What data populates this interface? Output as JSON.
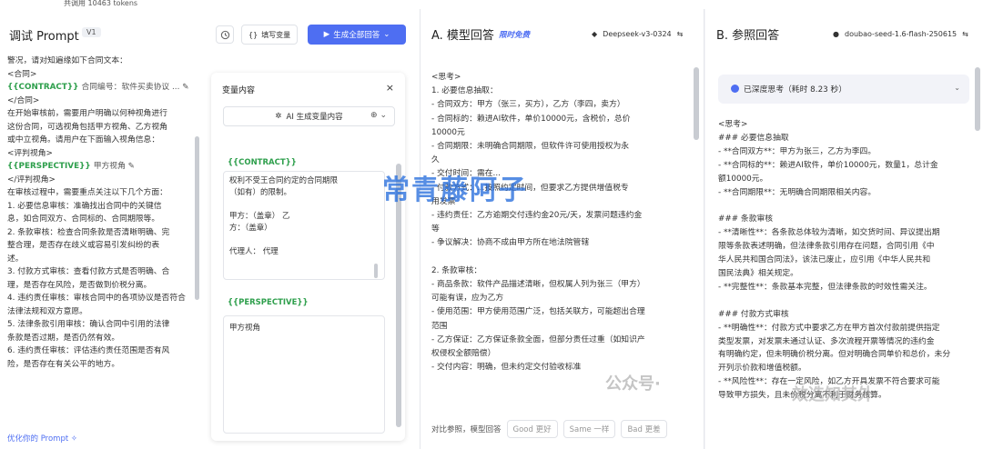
{
  "header": {
    "tokens": "共调用 10463 tokens"
  },
  "left": {
    "title": "调试 Prompt",
    "version": "V1",
    "var_fill_label": "填写变量",
    "generate_label": "生成全部回答",
    "prompt_lines": [
      "警况，请对知遍缘如下合同文本：",
      "<合同>",
      "{{CONTRACT}}|合同编号：软件买卖协议 ...",
      "</合同>",
      "在开始审核前，需要用户明确以何种视角进行",
      "这份合同，可选视角包括甲方视角、乙方视角",
      "或中立视角。请用户在下面输入视角信息：",
      "<评判视角>",
      "{{PERSPECTIVE}}|甲方视角",
      "</评判视角>",
      "在审核过程中，需要重点关注以下几个方面：",
      "1. 必要信息审核：准确找出合同中的关键信",
      "息，如合同双方、合同标的、合同期限等。",
      "2. 条款审核：检查合同条款是否清晰明确、完",
      "整合理，是否存在歧义或容易引发纠纷的表",
      "述。",
      "3. 付款方式审核：查看付款方式是否明确、合",
      "理，是否存在风险，是否做到价税分离。",
      "4. 违约责任审核：审核合同中的各项协议是否符合",
      "法律法规和双方意愿。",
      "5. 法律条款引用审核：确认合同中引用的法律",
      "条款是否过期，是否仍然有效。",
      "6. 违约责任审核：评估违约责任范围是否有风",
      "险，是否存在有关公平的地方。"
    ],
    "optimize_label": "优化你的 Prompt",
    "var_panel": {
      "title": "变量内容",
      "ai_button": "AI 生成变量内容",
      "contract_tag": "{{CONTRACT}}",
      "contract_lines": [
        "权利不受王合同约定的合同期限",
        "（如有）的限制。",
        "",
        "甲方：（盖章）                    乙",
        "方：（盖章）",
        "",
        "代理人：                           代理"
      ],
      "perspective_tag": "{{PERSPECTIVE}}",
      "perspective_value": "甲方视角"
    }
  },
  "middle": {
    "title": "A. 模型回答",
    "badge": "限时免费",
    "model": "Deepseek-v3-0324",
    "lines": [
      "<思考>",
      "1. 必要信息抽取：",
      "  - 合同双方：甲方（张三，买方），乙方（李四，卖方）",
      "  - 合同标的：赖进AI软件，单价10000元，含税价，总价",
      "10000元",
      "  - 合同期限：未明确合同期限，但软件许可使用授权为永",
      "久",
      "  - 交付时间：需在...",
      "  - 付款方式：...按照约定时间，但要求乙方提供增值税专",
      "用发票",
      "  - 违约责任：乙方逾期交付违约金20元/天，发票问题违约金",
      "等",
      "  - 争议解决：协商不成由甲方所在地法院管辖",
      "",
      "2. 条款审核：",
      "  - 商品条款：软件产品描述清晰，但权属人列为张三（甲方）",
      "可能有误，应为乙方",
      "  - 使用范围：甲方使用范围广泛，包括关联方，可能超出合理",
      "范围",
      "  - 乙方保证：乙方保证条款全面，但部分责任过重（如知识产",
      "权侵权全额赔偿）",
      "  - 交付内容：明确，但未约定交付验收标准"
    ],
    "compare_label": "对比参照，模型回答",
    "good": "Good 更好",
    "same": "Same 一样",
    "bad": "Bad 更差"
  },
  "right": {
    "title": "B. 参照回答",
    "model": "doubao-seed-1.6-flash-250615",
    "think_label": "已深度思考（耗时 8.23 秒）",
    "lines": [
      "<思考>",
      "### 必要信息抽取",
      "- **合同双方**：甲方为张三，乙方为李四。",
      "- **合同标的**：赖进AI软件，单价10000元，数量1，总计金",
      "额10000元。",
      "- **合同期限**：无明确合同期限相关内容。",
      "",
      "### 条款审核",
      "- **清晰性**：各条款总体较为清晰，如交货时间、异议提出期",
      "限等条款表述明确，但法律条款引用存在问题，合同引用《中",
      "华人民共和国合同法》，该法已废止，应引用《中华人民共和",
      "国民法典》相关规定。",
      "- **完整性**：条款基本完整，但法律条款的时效性需关注。",
      "",
      "### 付款方式审核",
      "- **明确性**：付款方式中要求乙方在甲方首次付款前提供指定",
      "类型发票，对发票未通过认证、多次流程开票等情况的违约金",
      "有明确约定，但未明确价税分离。但对明确合同单价和总价，未分",
      "开列示价款和增值税额。",
      "- **风险性**：存在一定风险，如乙方开具发票不符合要求可能",
      "导致甲方损失，且未价税分离不利于财务核算。"
    ]
  },
  "watermark": {
    "main": "常青藤阿子",
    "footer_a": "公众号·",
    "footer_b": "效选知其外"
  }
}
